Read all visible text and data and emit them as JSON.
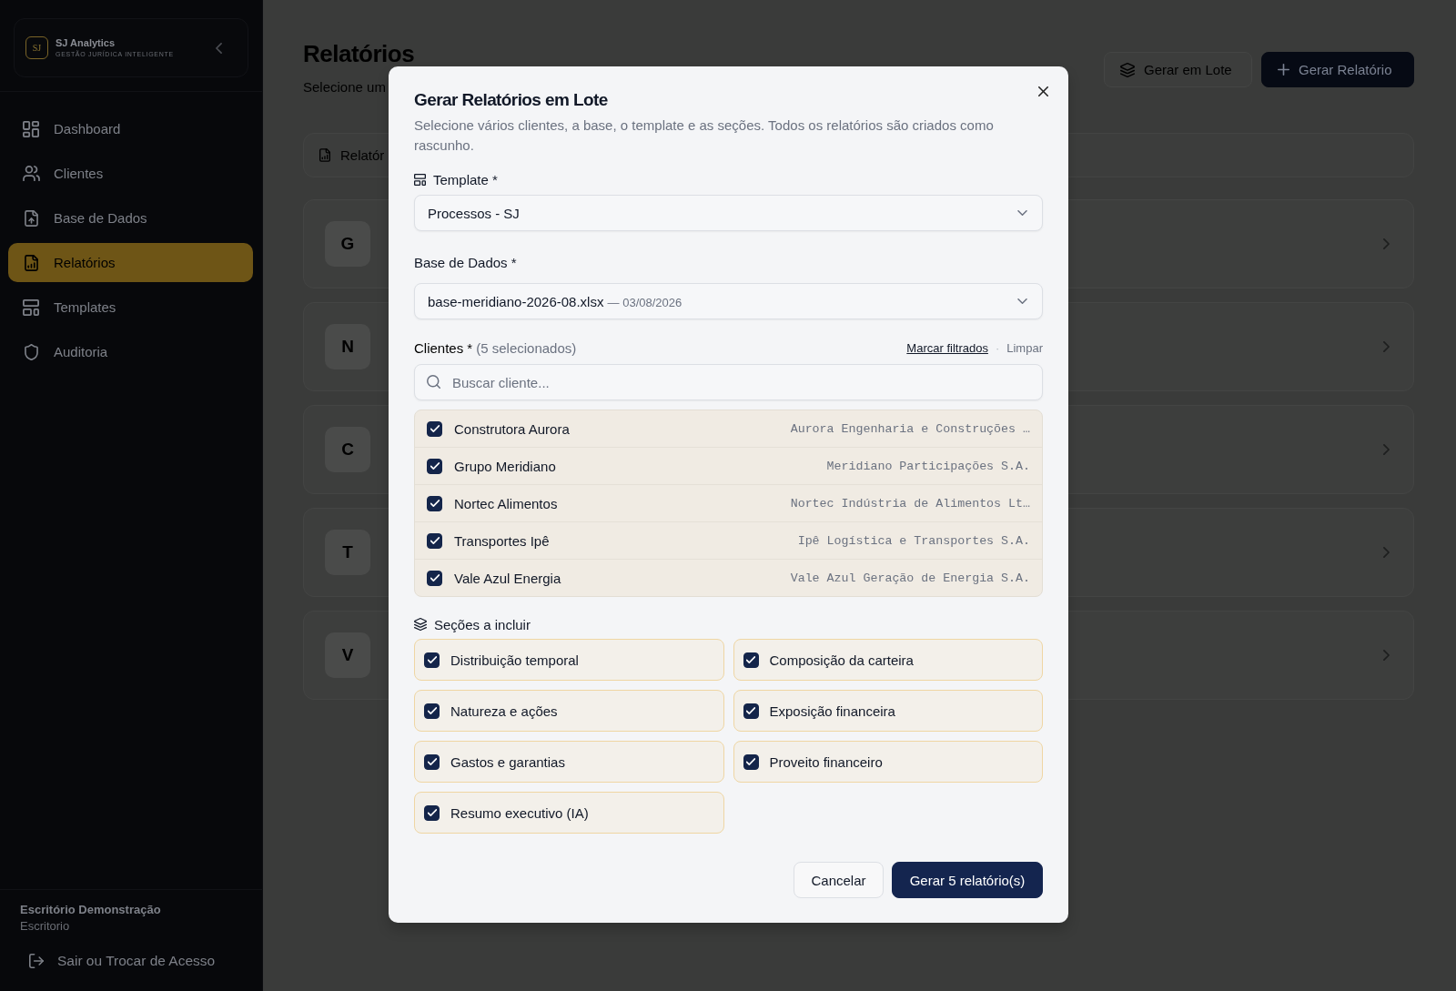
{
  "sidebar": {
    "brand": {
      "logo": "SJ",
      "name": "SJ Analytics",
      "tagline": "GESTÃO JURÍDICA INTELIGENTE"
    },
    "items": [
      {
        "label": "Dashboard",
        "selected": false
      },
      {
        "label": "Clientes",
        "selected": false
      },
      {
        "label": "Base de Dados",
        "selected": false
      },
      {
        "label": "Relatórios",
        "selected": true
      },
      {
        "label": "Templates",
        "selected": false
      },
      {
        "label": "Auditoria",
        "selected": false
      }
    ],
    "account": {
      "name": "Escritório Demonstração",
      "role": "Escritorio"
    },
    "logout": "Sair ou Trocar de Acesso"
  },
  "page": {
    "title": "Relatórios",
    "subtitle": "Selecione um",
    "actions": [
      {
        "label": "Gerar em Lote",
        "kind": "outline"
      },
      {
        "label": "Gerar Relatório",
        "kind": "primary"
      }
    ],
    "tab": "Relatór",
    "cards": [
      {
        "initial": "G"
      },
      {
        "initial": "N"
      },
      {
        "initial": "C"
      },
      {
        "initial": "T"
      },
      {
        "initial": "V"
      }
    ]
  },
  "dialog": {
    "title": "Gerar Relatórios em Lote",
    "description": "Selecione vários clientes, a base, o template e as seções. Todos os relatórios são criados como rascunho.",
    "template": {
      "label": "Template *",
      "value": "Processos - SJ"
    },
    "database": {
      "label": "Base de Dados *",
      "value": "base-meridiano-2026-08.xlsx",
      "date": "— 03/08/2026"
    },
    "clients": {
      "label": "Clientes *",
      "count": "(5 selecionados)",
      "select_filtered": "Marcar filtrados",
      "separator": "·",
      "clear": "Limpar",
      "search": {
        "placeholder": "Buscar cliente..."
      },
      "items": [
        {
          "name": "Construtora Aurora",
          "legal_name": "Aurora Engenharia e Construções …",
          "checked": true
        },
        {
          "name": "Grupo Meridiano",
          "legal_name": "Meridiano Participações S.A.",
          "checked": true
        },
        {
          "name": "Nortec Alimentos",
          "legal_name": "Nortec Indústria de Alimentos Lt…",
          "checked": true
        },
        {
          "name": "Transportes Ipê",
          "legal_name": "Ipê Logística e Transportes S.A.",
          "checked": true
        },
        {
          "name": "Vale Azul Energia",
          "legal_name": "Vale Azul Geração de Energia S.A.",
          "checked": true
        }
      ]
    },
    "sections": {
      "label": "Seções a incluir",
      "items": [
        {
          "label": "Distribuição temporal",
          "checked": true
        },
        {
          "label": "Composição da carteira",
          "checked": true
        },
        {
          "label": "Natureza e ações",
          "checked": true
        },
        {
          "label": "Exposição financeira",
          "checked": true
        },
        {
          "label": "Gastos e garantias",
          "checked": true
        },
        {
          "label": "Proveito financeiro",
          "checked": true
        },
        {
          "label": "Resumo executivo (IA)",
          "checked": true
        }
      ]
    },
    "buttons": [
      {
        "label": "Cancelar",
        "kind": "secondary"
      },
      {
        "label": "Gerar 5 relatório(s)",
        "kind": "primary"
      }
    ]
  }
}
